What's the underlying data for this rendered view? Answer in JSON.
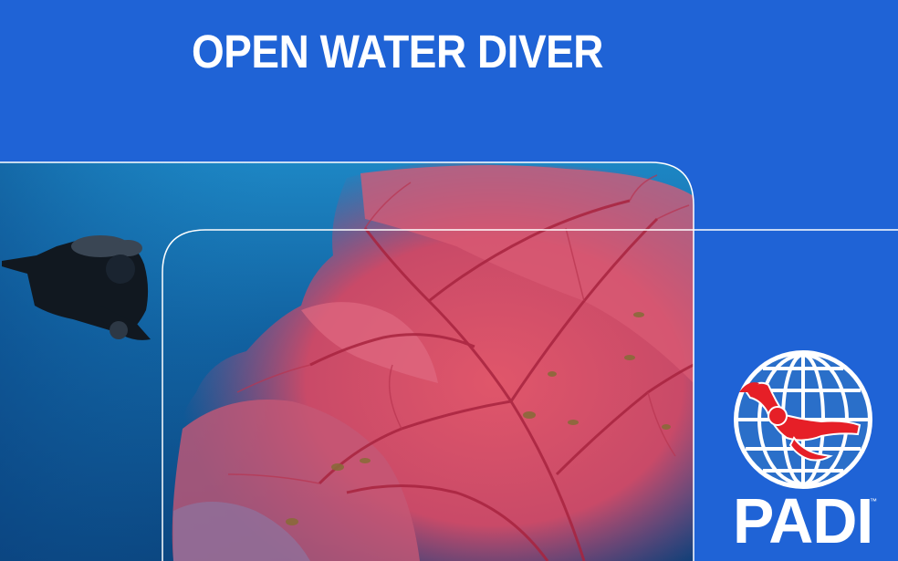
{
  "card": {
    "title": "OPEN WATER DIVER",
    "background_color": "#1f63d6",
    "accent_color": "#ffffff"
  },
  "photo": {
    "subject": "scuba diver beside red sea fan coral",
    "water_color": "#0f5aa0",
    "coral_color": "#d8536a"
  },
  "logo": {
    "wordmark": "PADI",
    "trademark": "™",
    "icon": "globe-diver-icon",
    "globe_color": "#2a6fc9",
    "diver_color": "#e61f27"
  }
}
